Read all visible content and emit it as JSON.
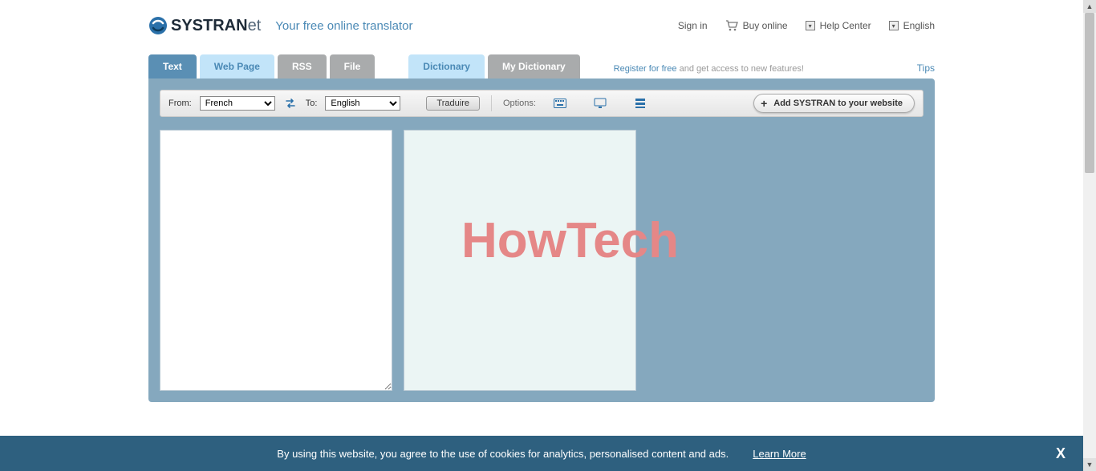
{
  "header": {
    "brand_main": "SYSTRAN",
    "brand_suffix": "et",
    "tagline": "Your free online translator",
    "signin": "Sign in",
    "buy": "Buy online",
    "help": "Help Center",
    "lang": "English"
  },
  "tabs": {
    "text": "Text",
    "webpage": "Web Page",
    "rss": "RSS",
    "file": "File",
    "dictionary": "Dictionary",
    "mydictionary": "My Dictionary"
  },
  "register": {
    "link": "Register for free",
    "rest": " and get access to new features!"
  },
  "tips": "Tips",
  "toolbar": {
    "from_label": "From:",
    "to_label": "To:",
    "from_value": "French",
    "to_value": "English",
    "translate": "Traduire",
    "options_label": "Options:",
    "add_systran": "Add SYSTRAN to your website"
  },
  "watermark": "HowTech",
  "cookie": {
    "text": "By using this website, you agree to the use of cookies for analytics, personalised content and ads.",
    "learn": "Learn More",
    "close": "X"
  }
}
